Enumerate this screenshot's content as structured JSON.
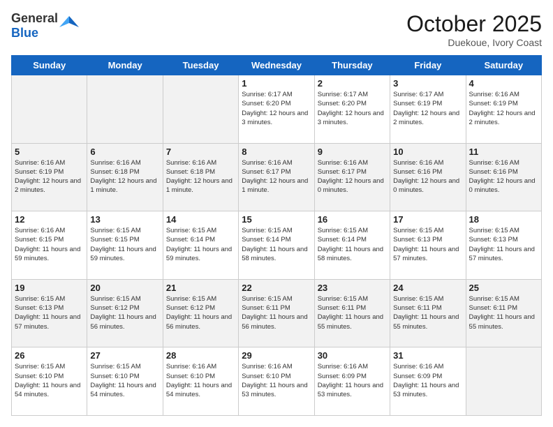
{
  "header": {
    "logo": {
      "general": "General",
      "blue": "Blue"
    },
    "title": "October 2025",
    "subtitle": "Duekoue, Ivory Coast"
  },
  "weekdays": [
    "Sunday",
    "Monday",
    "Tuesday",
    "Wednesday",
    "Thursday",
    "Friday",
    "Saturday"
  ],
  "weeks": [
    [
      {
        "day": "",
        "info": ""
      },
      {
        "day": "",
        "info": ""
      },
      {
        "day": "",
        "info": ""
      },
      {
        "day": "1",
        "info": "Sunrise: 6:17 AM\nSunset: 6:20 PM\nDaylight: 12 hours and 3 minutes."
      },
      {
        "day": "2",
        "info": "Sunrise: 6:17 AM\nSunset: 6:20 PM\nDaylight: 12 hours and 3 minutes."
      },
      {
        "day": "3",
        "info": "Sunrise: 6:17 AM\nSunset: 6:19 PM\nDaylight: 12 hours and 2 minutes."
      },
      {
        "day": "4",
        "info": "Sunrise: 6:16 AM\nSunset: 6:19 PM\nDaylight: 12 hours and 2 minutes."
      }
    ],
    [
      {
        "day": "5",
        "info": "Sunrise: 6:16 AM\nSunset: 6:19 PM\nDaylight: 12 hours and 2 minutes."
      },
      {
        "day": "6",
        "info": "Sunrise: 6:16 AM\nSunset: 6:18 PM\nDaylight: 12 hours and 1 minute."
      },
      {
        "day": "7",
        "info": "Sunrise: 6:16 AM\nSunset: 6:18 PM\nDaylight: 12 hours and 1 minute."
      },
      {
        "day": "8",
        "info": "Sunrise: 6:16 AM\nSunset: 6:17 PM\nDaylight: 12 hours and 1 minute."
      },
      {
        "day": "9",
        "info": "Sunrise: 6:16 AM\nSunset: 6:17 PM\nDaylight: 12 hours and 0 minutes."
      },
      {
        "day": "10",
        "info": "Sunrise: 6:16 AM\nSunset: 6:16 PM\nDaylight: 12 hours and 0 minutes."
      },
      {
        "day": "11",
        "info": "Sunrise: 6:16 AM\nSunset: 6:16 PM\nDaylight: 12 hours and 0 minutes."
      }
    ],
    [
      {
        "day": "12",
        "info": "Sunrise: 6:16 AM\nSunset: 6:15 PM\nDaylight: 11 hours and 59 minutes."
      },
      {
        "day": "13",
        "info": "Sunrise: 6:15 AM\nSunset: 6:15 PM\nDaylight: 11 hours and 59 minutes."
      },
      {
        "day": "14",
        "info": "Sunrise: 6:15 AM\nSunset: 6:14 PM\nDaylight: 11 hours and 59 minutes."
      },
      {
        "day": "15",
        "info": "Sunrise: 6:15 AM\nSunset: 6:14 PM\nDaylight: 11 hours and 58 minutes."
      },
      {
        "day": "16",
        "info": "Sunrise: 6:15 AM\nSunset: 6:14 PM\nDaylight: 11 hours and 58 minutes."
      },
      {
        "day": "17",
        "info": "Sunrise: 6:15 AM\nSunset: 6:13 PM\nDaylight: 11 hours and 57 minutes."
      },
      {
        "day": "18",
        "info": "Sunrise: 6:15 AM\nSunset: 6:13 PM\nDaylight: 11 hours and 57 minutes."
      }
    ],
    [
      {
        "day": "19",
        "info": "Sunrise: 6:15 AM\nSunset: 6:13 PM\nDaylight: 11 hours and 57 minutes."
      },
      {
        "day": "20",
        "info": "Sunrise: 6:15 AM\nSunset: 6:12 PM\nDaylight: 11 hours and 56 minutes."
      },
      {
        "day": "21",
        "info": "Sunrise: 6:15 AM\nSunset: 6:12 PM\nDaylight: 11 hours and 56 minutes."
      },
      {
        "day": "22",
        "info": "Sunrise: 6:15 AM\nSunset: 6:11 PM\nDaylight: 11 hours and 56 minutes."
      },
      {
        "day": "23",
        "info": "Sunrise: 6:15 AM\nSunset: 6:11 PM\nDaylight: 11 hours and 55 minutes."
      },
      {
        "day": "24",
        "info": "Sunrise: 6:15 AM\nSunset: 6:11 PM\nDaylight: 11 hours and 55 minutes."
      },
      {
        "day": "25",
        "info": "Sunrise: 6:15 AM\nSunset: 6:11 PM\nDaylight: 11 hours and 55 minutes."
      }
    ],
    [
      {
        "day": "26",
        "info": "Sunrise: 6:15 AM\nSunset: 6:10 PM\nDaylight: 11 hours and 54 minutes."
      },
      {
        "day": "27",
        "info": "Sunrise: 6:15 AM\nSunset: 6:10 PM\nDaylight: 11 hours and 54 minutes."
      },
      {
        "day": "28",
        "info": "Sunrise: 6:16 AM\nSunset: 6:10 PM\nDaylight: 11 hours and 54 minutes."
      },
      {
        "day": "29",
        "info": "Sunrise: 6:16 AM\nSunset: 6:10 PM\nDaylight: 11 hours and 53 minutes."
      },
      {
        "day": "30",
        "info": "Sunrise: 6:16 AM\nSunset: 6:09 PM\nDaylight: 11 hours and 53 minutes."
      },
      {
        "day": "31",
        "info": "Sunrise: 6:16 AM\nSunset: 6:09 PM\nDaylight: 11 hours and 53 minutes."
      },
      {
        "day": "",
        "info": ""
      }
    ]
  ]
}
